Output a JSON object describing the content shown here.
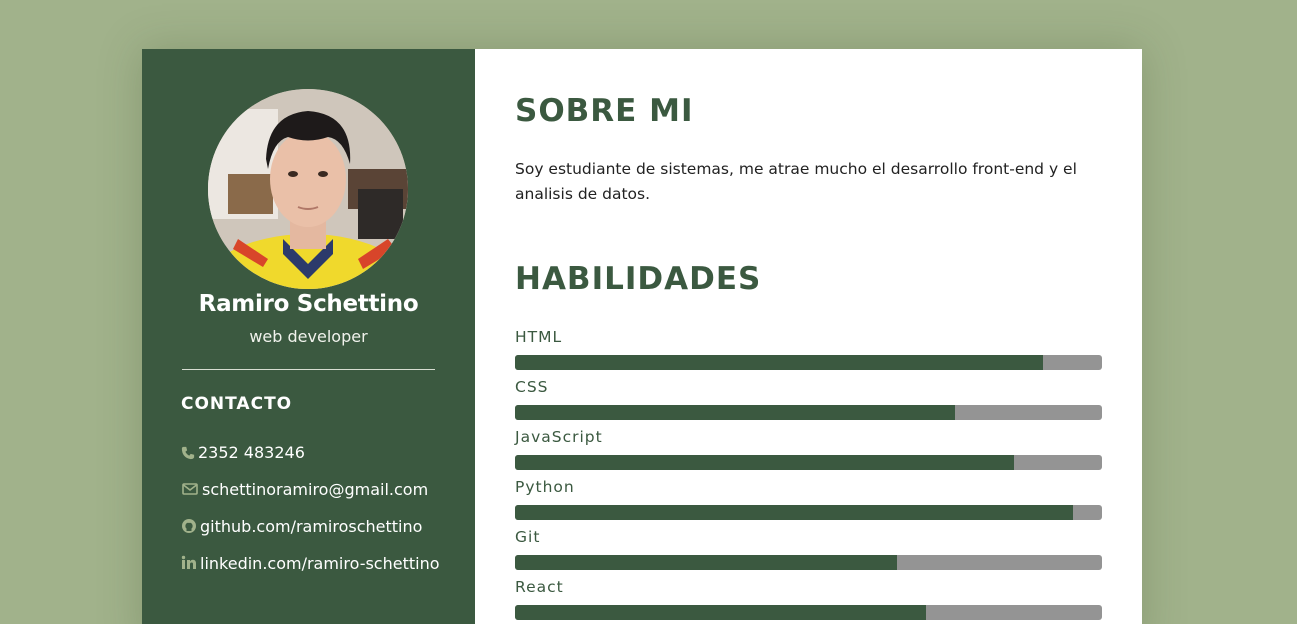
{
  "profile": {
    "name": "Ramiro Schettino",
    "role": "web developer"
  },
  "contact": {
    "title": "CONTACTO",
    "items": [
      {
        "icon": "phone-icon",
        "text": "2352 483246"
      },
      {
        "icon": "envelope-icon",
        "text": "schettinoramiro@gmail.com"
      },
      {
        "icon": "github-icon",
        "text": "github.com/ramiroschettino"
      },
      {
        "icon": "linkedin-icon",
        "text": "linkedin.com/ramiro-schettino"
      }
    ]
  },
  "about": {
    "title": "SOBRE MI",
    "text": "Soy estudiante de sistemas, me atrae mucho el desarrollo front-end y el analisis de datos."
  },
  "skills": {
    "title": "HABILIDADES",
    "items": [
      {
        "label": "HTML",
        "level": 0.9
      },
      {
        "label": "CSS",
        "level": 0.75
      },
      {
        "label": "JavaScript",
        "level": 0.85
      },
      {
        "label": "Python",
        "level": 0.95
      },
      {
        "label": "Git",
        "level": 0.65
      },
      {
        "label": "React",
        "level": 0.7
      }
    ]
  },
  "colors": {
    "page_bg": "#a1b28b",
    "sidebar_bg": "#3b5940",
    "accent": "#3b5940",
    "track": "#949494"
  }
}
